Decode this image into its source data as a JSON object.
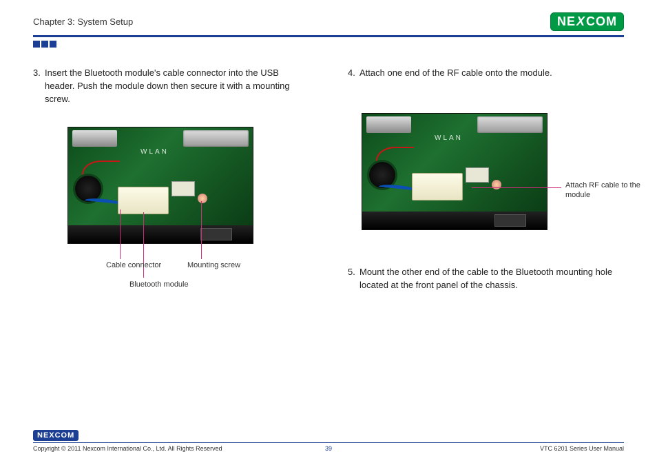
{
  "header": {
    "chapter": "Chapter 3: System Setup",
    "logo_text": "NE COM",
    "logo_x": "X"
  },
  "left": {
    "step3_num": "3.",
    "step3_text": "Insert the Bluetooth module's cable connector into the USB header. Push the module down then secure it with a mounting screw.",
    "label_cable": "Cable connector",
    "label_bt": "Bluetooth module",
    "label_screw": "Mounting screw",
    "wlan": "WLAN"
  },
  "right": {
    "step4_num": "4.",
    "step4_text": "Attach one end of the RF cable onto the module.",
    "callout_rf": "Attach RF cable to the module",
    "step5_num": "5.",
    "step5_text": "Mount the other end of the cable to the Bluetooth mounting hole located at the front panel of the chassis.",
    "wlan": "WLAN"
  },
  "footer": {
    "logo": "NEXCOM",
    "copyright": "Copyright © 2011 Nexcom International Co., Ltd. All Rights Reserved",
    "page": "39",
    "manual": "VTC 6201 Series User Manual"
  }
}
